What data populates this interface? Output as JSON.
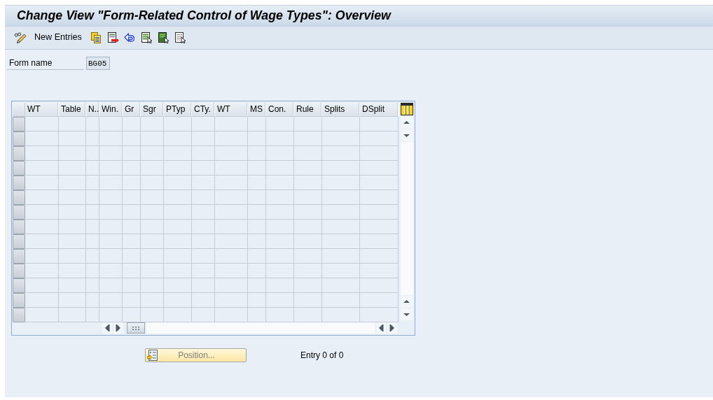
{
  "window": {
    "title": "Change View \"Form-Related Control of Wage Types\": Overview"
  },
  "toolbar": {
    "new_entries": "New Entries"
  },
  "form_name": {
    "label": "Form name",
    "value": "BG05"
  },
  "table": {
    "columns": [
      "WT",
      "Table",
      "N..",
      "Win.",
      "Gr",
      "Sgr",
      "PTyp",
      "CTy.",
      "WT",
      "MS",
      "Con.",
      "Rule",
      "Splits",
      "DSplit"
    ]
  },
  "footer": {
    "position_button": {
      "label": "Position...",
      "disabled": true
    },
    "entry_count": "Entry 0 of 0"
  }
}
